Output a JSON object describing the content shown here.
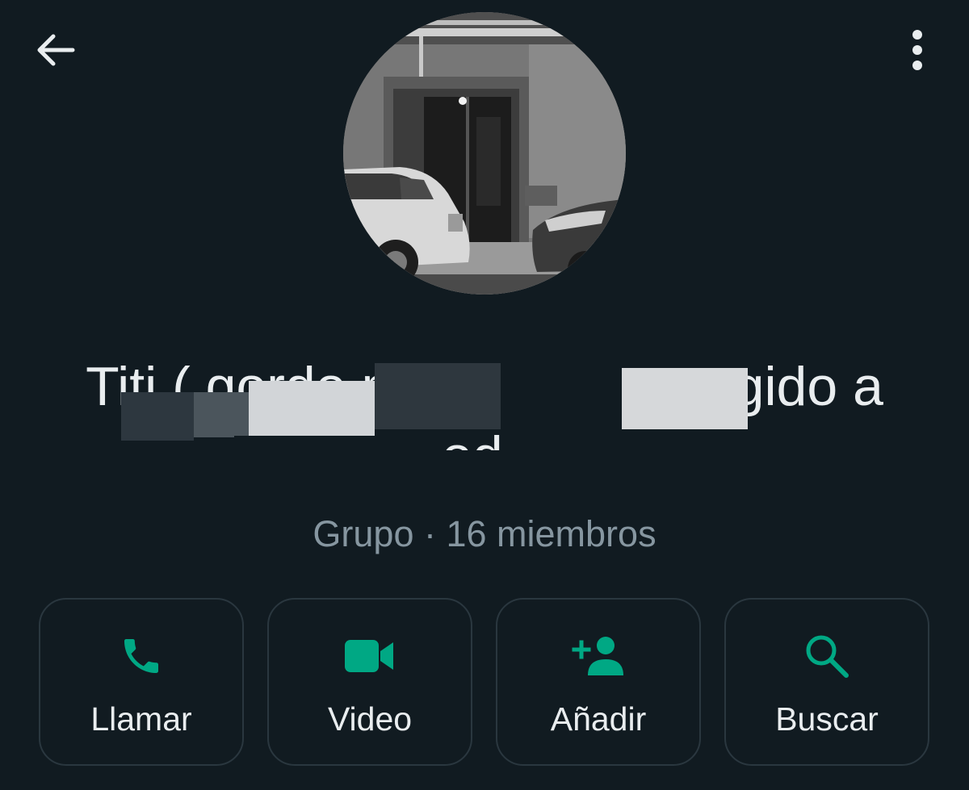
{
  "header": {
    "back_icon": "arrow-left-icon",
    "menu_icon": "more-vertical-icon"
  },
  "group": {
    "name_line1": "Titi ( gordo mala leche apegido a",
    "name_line2": "Rodo )",
    "subtitle": "Grupo · 16 miembros"
  },
  "actions": [
    {
      "label": "Llamar",
      "icon": "phone-icon"
    },
    {
      "label": "Video",
      "icon": "video-camera-icon"
    },
    {
      "label": "Añadir",
      "icon": "add-person-icon"
    },
    {
      "label": "Buscar",
      "icon": "search-icon"
    }
  ],
  "colors": {
    "background": "#111b21",
    "accent": "#00a884",
    "subtitle": "#8696a0",
    "button_border": "#2a373f"
  }
}
